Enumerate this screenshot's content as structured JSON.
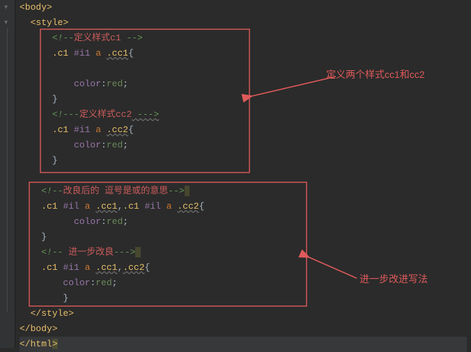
{
  "code": {
    "l1": {
      "open": "<",
      "tag": "body",
      "close": ">"
    },
    "l2": {
      "open": "<",
      "tag": "style",
      "close": ">"
    },
    "l3": {
      "cm_open": "<!--",
      "cm_text": "定义样式c1 ",
      "cm_close": "-->"
    },
    "l4": {
      "c1": ".c1",
      "sp1": " ",
      "id": "#i1",
      "sp2": " ",
      "a": "a",
      "sp3": " ",
      "cc": ".cc1",
      "brace": "{"
    },
    "l5": "",
    "l6": {
      "prop": "color",
      "colon": ":",
      "val": "red",
      "semi": ";"
    },
    "l7": {
      "brace": "}"
    },
    "l8": {
      "cm_open": "<!--",
      "dash": "-",
      "cm_text": "定义样式cc2",
      "cm_close": " --->"
    },
    "l9": {
      "c1": ".c1",
      "sp1": " ",
      "id": "#i1",
      "sp2": " ",
      "a": "a",
      "sp3": " ",
      "cc": ".cc2",
      "brace": "{"
    },
    "l10": {
      "prop": "color",
      "colon": ":",
      "val": "red",
      "semi": ";"
    },
    "l11": {
      "brace": "}"
    },
    "l12": "",
    "l13": {
      "cm_open": "<!--",
      "cm_text": "改良后的 逗号是或的意思",
      "cm_close": "-->"
    },
    "l14": {
      "c1a": ".c1",
      "id_a": "#il",
      "a_a": "a",
      "cc1": ".cc1",
      "comma": ",",
      "c1b": ".c1",
      "id_b": "#il",
      "a_b": "a",
      "cc2": ".cc2",
      "brace": "{"
    },
    "l15": {
      "prop": "color",
      "colon": ":",
      "val": "red",
      "semi": ";"
    },
    "l16": {
      "brace": "}"
    },
    "l17": {
      "cm_open": "<!--",
      "cm_text": " 进一步改良",
      "cm_close": "--->"
    },
    "l18": {
      "c1": ".c1",
      "id": "#i1",
      "a": "a",
      "cc1": ".cc1",
      "comma": ",",
      "cc2": ".cc2",
      "brace": "{"
    },
    "l19": {
      "prop": "color",
      "colon": ":",
      "val": "red",
      "semi": ";"
    },
    "l20": {
      "brace": "}"
    },
    "l21": {
      "open": "</",
      "tag": "style",
      "close": ">"
    },
    "l22": {
      "open": "</",
      "tag": "body",
      "close": ">"
    },
    "l23": {
      "open": "</",
      "tag": "html",
      "close": ">"
    }
  },
  "annotations": {
    "top": "定义两个样式cc1和cc2",
    "bottom": "进一步改进写法"
  }
}
